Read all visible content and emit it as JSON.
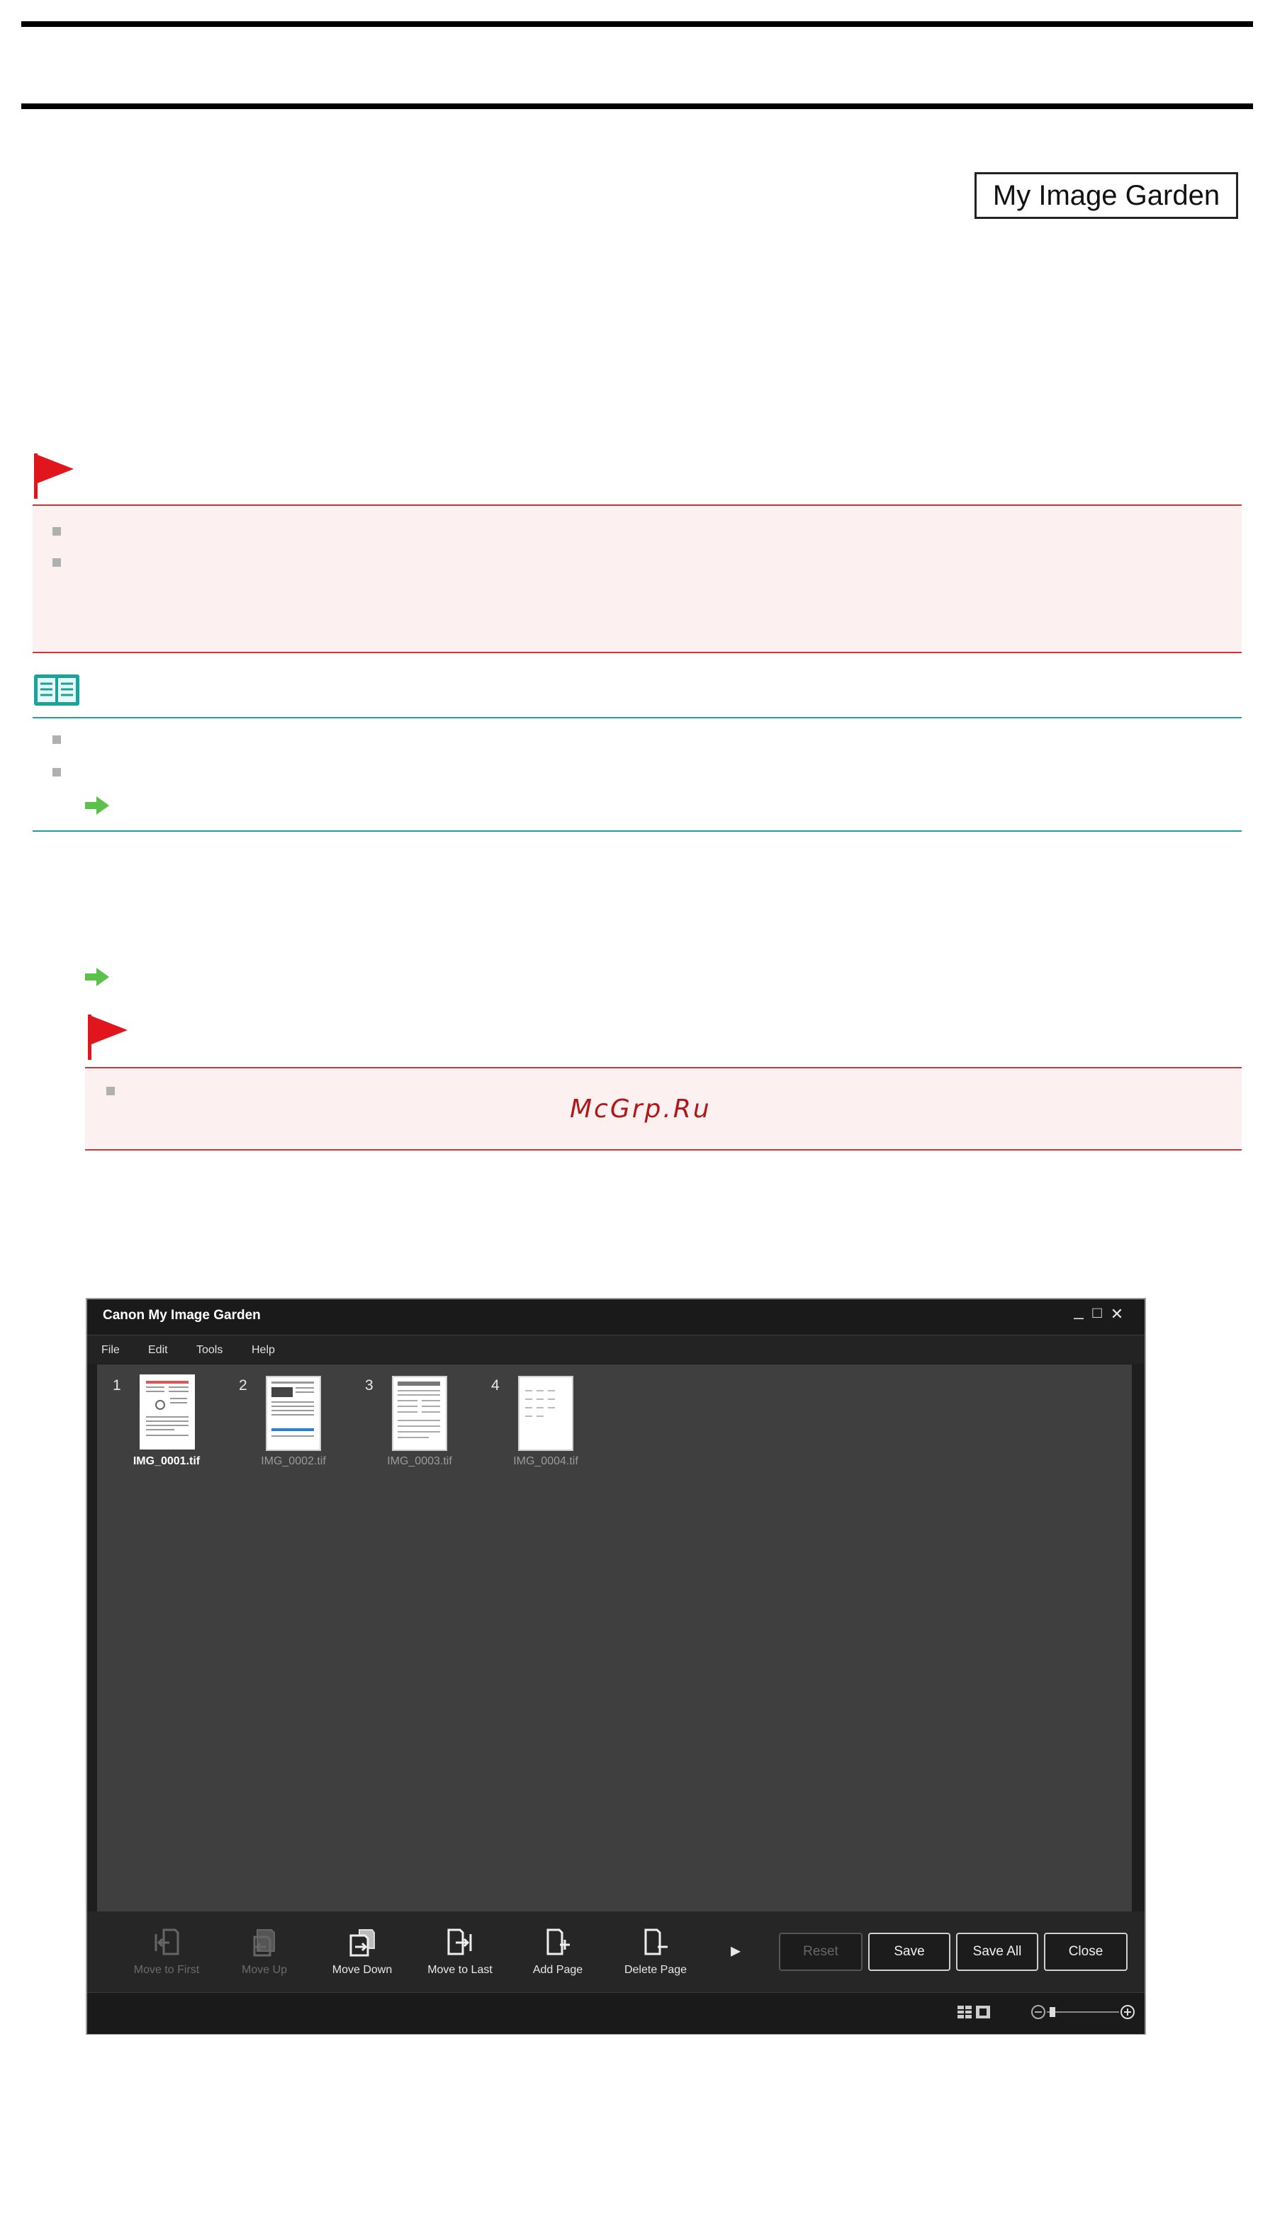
{
  "header": {
    "app_badge": "My Image Garden"
  },
  "watermark": "McGrp.Ru",
  "app_window": {
    "title": "Canon My Image Garden",
    "window_controls": {
      "minimize": "_",
      "maximize": "□",
      "close": "✕"
    },
    "menu": [
      "File",
      "Edit",
      "Tools",
      "Help"
    ],
    "thumbnails": [
      {
        "num": "1",
        "name": "IMG_0001.tif",
        "selected": true
      },
      {
        "num": "2",
        "name": "IMG_0002.tif",
        "selected": false
      },
      {
        "num": "3",
        "name": "IMG_0003.tif",
        "selected": false
      },
      {
        "num": "4",
        "name": "IMG_0004.tif",
        "selected": false
      }
    ],
    "tools": [
      {
        "label": "Move to First",
        "enabled": false,
        "icon": "move-to-first-icon"
      },
      {
        "label": "Move Up",
        "enabled": false,
        "icon": "move-up-icon"
      },
      {
        "label": "Move Down",
        "enabled": true,
        "icon": "move-down-icon"
      },
      {
        "label": "Move to Last",
        "enabled": true,
        "icon": "move-to-last-icon"
      },
      {
        "label": "Add Page",
        "enabled": true,
        "icon": "add-page-icon"
      },
      {
        "label": "Delete Page",
        "enabled": true,
        "icon": "delete-page-icon"
      }
    ],
    "more_tools": "▸",
    "buttons": {
      "reset": "Reset",
      "save": "Save",
      "save_all": "Save All",
      "close": "Close"
    }
  }
}
